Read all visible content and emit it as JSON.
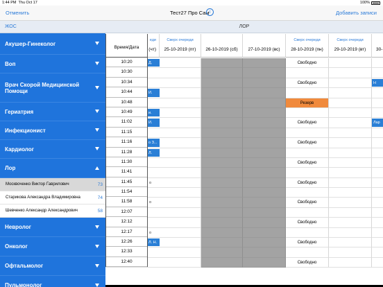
{
  "status": {
    "time": "1:44 PM",
    "date": "Thu Oct 17",
    "battery": "100%"
  },
  "nav": {
    "cancel": "Отменить",
    "title": "Тест27 Про Сам",
    "add": "Добавить записи"
  },
  "sidebar": {
    "header": "ЖОС",
    "items": [
      {
        "label": "Акушер-Гинеколог",
        "expanded": false
      },
      {
        "label": "Воп",
        "expanded": false
      },
      {
        "label": "Врач Скорой Медицинской Помощи",
        "expanded": false
      },
      {
        "label": "Гериатрия",
        "expanded": false
      },
      {
        "label": "Инфекционист",
        "expanded": false
      },
      {
        "label": "Кардиолог",
        "expanded": false
      },
      {
        "label": "Лор",
        "expanded": true,
        "doctors": [
          {
            "name": "Москвоченко Виктор Гаврилович",
            "count": "73"
          },
          {
            "name": "Старикова Александра Владимировна",
            "count": "74"
          },
          {
            "name": "Шевченко Александр Александрович",
            "count": "58"
          }
        ]
      },
      {
        "label": "Невролог",
        "expanded": false
      },
      {
        "label": "Онколог",
        "expanded": false
      },
      {
        "label": "Офтальмолог",
        "expanded": false
      },
      {
        "label": "Пульмонолог",
        "expanded": false
      }
    ]
  },
  "main": {
    "header": "ЛОР",
    "time_header": "Время/Дата",
    "over_label": "Сверх очереди",
    "dates": [
      "(чт)",
      "25-10-2019 (пт)",
      "26-10-2019 (сб)",
      "27-10-2019 (вс)",
      "28-10-2019 (пн)",
      "29-10-2019 (вт)",
      "30-"
    ],
    "over_partial": "еди",
    "times": [
      "10:20",
      "10:30",
      "10:34",
      "10:44",
      "10:48",
      "10:49",
      "11:02",
      "11:15",
      "11:16",
      "11:28",
      "11:30",
      "11:41",
      "11:45",
      "11:54",
      "11:58",
      "12:07",
      "12:12",
      "12:17",
      "12:26",
      "12:33",
      "12:40"
    ],
    "free_label": "Свободно",
    "reserve_label": "Резерв",
    "col0_frags": [
      "Д.",
      "",
      "",
      "И.",
      "",
      "и.",
      "И.",
      "",
      "о З...",
      "Л.",
      "",
      "",
      "о",
      "",
      "о",
      "",
      "",
      "о",
      "Л. Н.",
      "",
      ""
    ],
    "col0_booked": [
      true,
      false,
      false,
      true,
      false,
      true,
      true,
      false,
      true,
      true,
      false,
      false,
      false,
      false,
      false,
      false,
      false,
      false,
      true,
      false,
      false
    ],
    "col4": [
      "free",
      "",
      "free",
      "",
      "reserve",
      "",
      "free",
      "",
      "free",
      "",
      "free",
      "",
      "free",
      "",
      "free",
      "",
      "free",
      "",
      "free",
      "",
      "free"
    ],
    "col6_frags": [
      "",
      "",
      "Н",
      "",
      "",
      "",
      "Лар",
      "",
      "",
      "",
      "",
      "",
      "",
      "",
      "",
      "",
      "",
      "",
      "",
      "",
      ""
    ]
  }
}
